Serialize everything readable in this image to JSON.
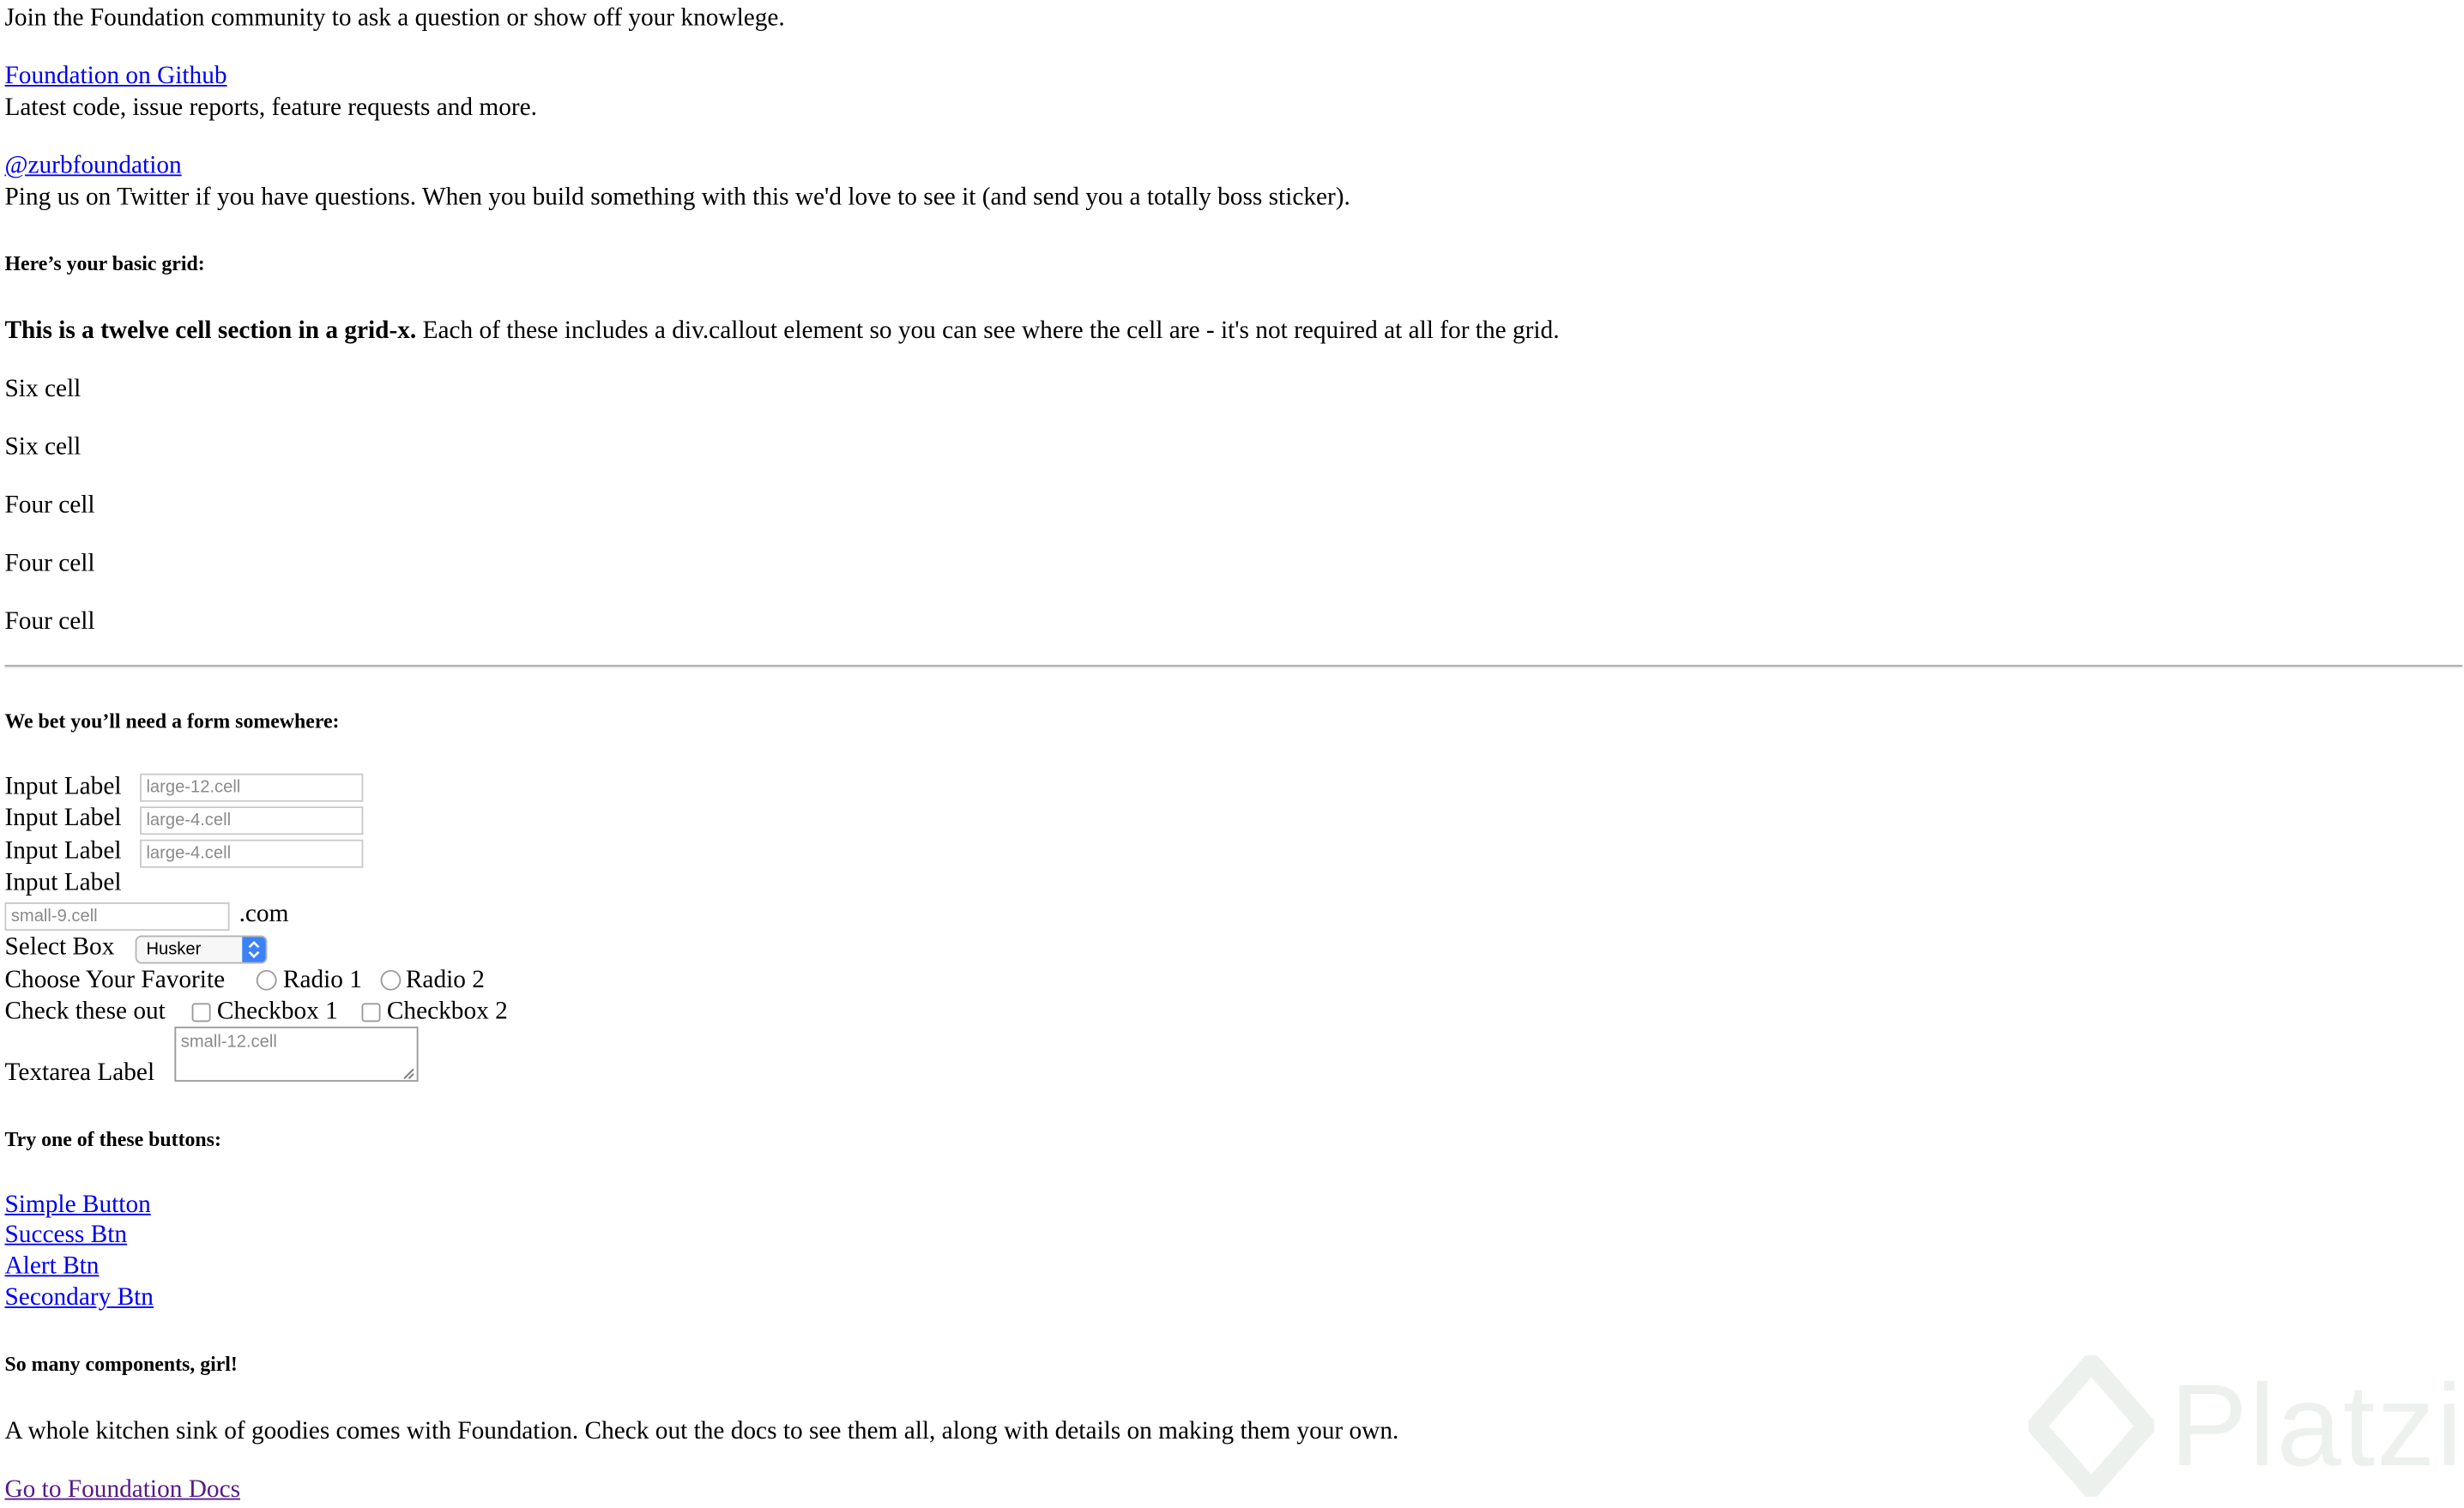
{
  "community": {
    "intro": "Join the Foundation community to ask a question or show off your knowlege.",
    "github_link": "Foundation on Github",
    "github_desc": "Latest code, issue reports, feature requests and more.",
    "twitter_link": "@zurbfoundation",
    "twitter_desc": "Ping us on Twitter if you have questions. When you build something with this we'd love to see it (and send you a totally boss sticker)."
  },
  "grid": {
    "heading": "Here’s your basic grid:",
    "twelve_bold": "This is a twelve cell section in a grid-x.",
    "twelve_rest": "Each of these includes a div.callout element so you can see where the cell are - it's not required at all for the grid.",
    "cells": [
      "Six cell",
      "Six cell",
      "Four cell",
      "Four cell",
      "Four cell"
    ]
  },
  "form": {
    "heading": "We bet you’ll need a form somewhere:",
    "input_label": "Input Label",
    "placeholders": [
      "large-12.cell",
      "large-4.cell",
      "large-4.cell"
    ],
    "small9_placeholder": "small-9.cell",
    "postfix": ".com",
    "select_label": "Select Box",
    "select_value": "Husker",
    "radio_label": "Choose Your Favorite",
    "radio1": "Radio 1",
    "radio2": "Radio 2",
    "check_label": "Check these out",
    "checkbox1": "Checkbox 1",
    "checkbox2": "Checkbox 2",
    "textarea_label": "Textarea Label",
    "textarea_placeholder": "small-12.cell"
  },
  "buttons": {
    "heading": "Try one of these buttons:",
    "items": [
      "Simple Button",
      "Success Btn",
      "Alert Btn",
      "Secondary Btn"
    ]
  },
  "components": {
    "heading": "So many components, girl!",
    "desc": "A whole kitchen sink of goodies comes with Foundation. Check out the docs to see them all, along with details on making them your own.",
    "docs_link": "Go to Foundation Docs"
  },
  "watermark": {
    "text": "Platzi",
    "icon": "platzi-logo-icon"
  },
  "colors": {
    "link": "#0000ee",
    "visited_link": "#551a8b",
    "select_arrow": "#3b82f6"
  }
}
